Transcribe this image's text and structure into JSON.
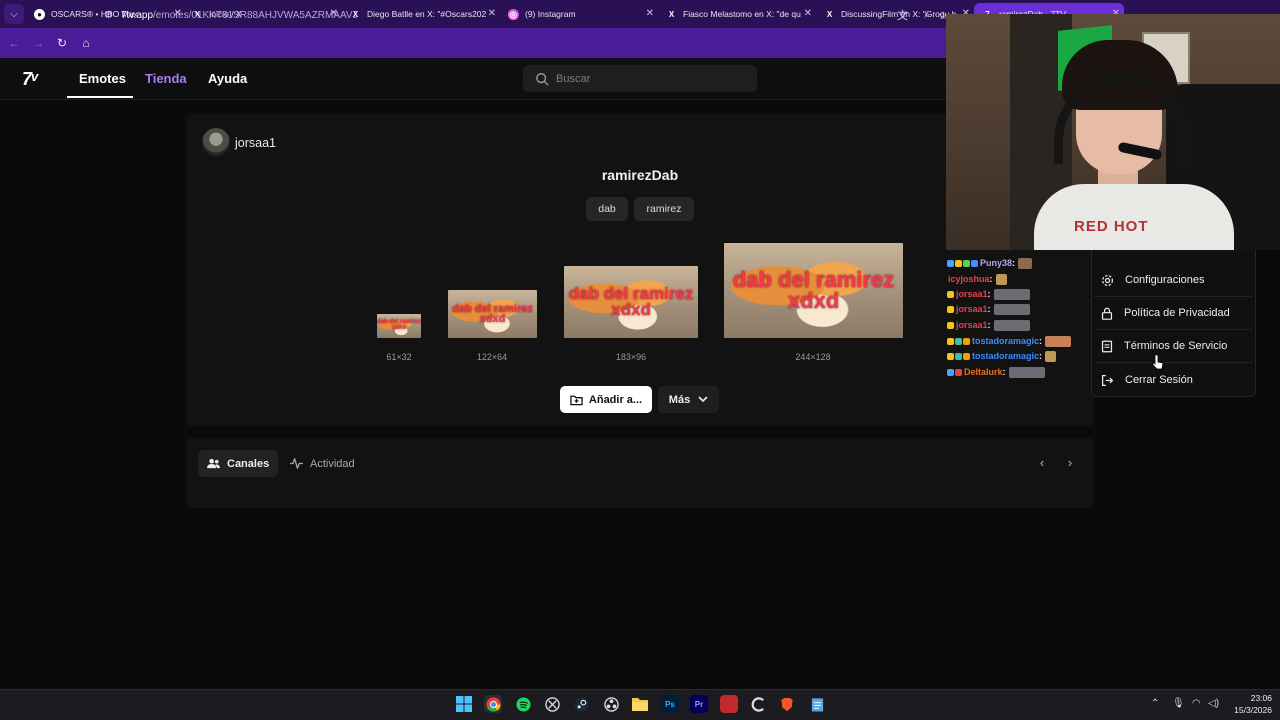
{
  "browser": {
    "tabs": [
      {
        "title": "OSCARS® • HBO Max",
        "icon": "hbo-icon",
        "active": false
      },
      {
        "title": "Inicio / X",
        "icon": "x-icon",
        "active": false
      },
      {
        "title": "Diego Batlle en X: \"#Oscars202",
        "icon": "x-icon",
        "active": false
      },
      {
        "title": "(9) Instagram",
        "icon": "instagram-icon",
        "active": false
      },
      {
        "title": "Fiasco Melastomo en X: \"de qu",
        "icon": "x-icon",
        "active": false
      },
      {
        "title": "DiscussingFilm en X: \"Grogu h",
        "icon": "x-icon",
        "active": false
      },
      {
        "title": "ramirezDab - 7TV",
        "icon": "7tv-icon",
        "active": true
      }
    ],
    "url_host": "7tv.app",
    "url_path": "/emotes/01KKT61SR88AHJVWA5AZRMAAVJ"
  },
  "site": {
    "logo": "7",
    "nav": {
      "emotes": "Emotes",
      "tienda": "Tienda",
      "ayuda": "Ayuda"
    },
    "search_placeholder": "Buscar",
    "accent": "#a77cf2"
  },
  "emote": {
    "uploader": "jorsaa1",
    "name": "ramirezDab",
    "tags": [
      "dab",
      "ramirez"
    ],
    "preview_caption": "dab del ramirez xdxd",
    "sizes": [
      "61×32",
      "122×64",
      "183×96",
      "244×128"
    ],
    "add_button": "Añadir a...",
    "more_button": "Más"
  },
  "tabs": {
    "canales": "Canales",
    "actividad": "Actividad"
  },
  "chat": [
    {
      "user": "Puny38",
      "color": "#b9a2f0",
      "badges": [
        "#4aa3ff",
        "#f5c518",
        "#5bd15b",
        "#4a8cff"
      ],
      "emote_color": "#8a6a50"
    },
    {
      "user": "icyjoshua",
      "color": "#e0444e",
      "badges": [],
      "emote_color": "#c09a55"
    },
    {
      "user": "jorsaa1",
      "color": "#e0444e",
      "badges": [
        "#f5c518"
      ],
      "emote_color": "#6c6c74"
    },
    {
      "user": "jorsaa1",
      "color": "#e0444e",
      "badges": [
        "#f5c518"
      ],
      "emote_color": "#6c6c74"
    },
    {
      "user": "jorsaa1",
      "color": "#e0444e",
      "badges": [
        "#f5c518"
      ],
      "emote_color": "#6c6c74"
    },
    {
      "user": "tostadoramagic",
      "color": "#3b8bff",
      "badges": [
        "#f5c518",
        "#38c2a3",
        "#f5a000"
      ],
      "emote_color": "#c8805a"
    },
    {
      "user": "tostadoramagic",
      "color": "#3b8bff",
      "badges": [
        "#f5c518",
        "#38c2a3",
        "#f5a000"
      ],
      "emote_color": "#c09a55"
    },
    {
      "user": "Deltalurk",
      "color": "#f06b1e",
      "badges": [
        "#4aa3ff",
        "#e84040"
      ],
      "emote_color": "#6c6c74"
    }
  ],
  "menu": {
    "items": [
      {
        "label": "Configuraciones",
        "icon": "gear-icon"
      },
      {
        "label": "Política de Privacidad",
        "icon": "lock-icon"
      },
      {
        "label": "Términos de Servicio",
        "icon": "document-icon"
      },
      {
        "label": "Cerrar Sesión",
        "icon": "logout-icon"
      }
    ]
  },
  "webcam": {
    "shirt_text": "RED HOT"
  },
  "taskbar": {
    "time": "23:06",
    "date": "15/3/2026",
    "apps": [
      "windows-start-icon",
      "chrome-icon",
      "spotify-icon",
      "xbox-icon",
      "steam-icon",
      "obs-icon",
      "file-explorer-icon",
      "photoshop-icon",
      "premiere-icon",
      "app-icon",
      "ccleaner-icon",
      "brave-icon",
      "notepad-icon"
    ],
    "ps_label": "Ps",
    "pr_label": "Pr"
  }
}
